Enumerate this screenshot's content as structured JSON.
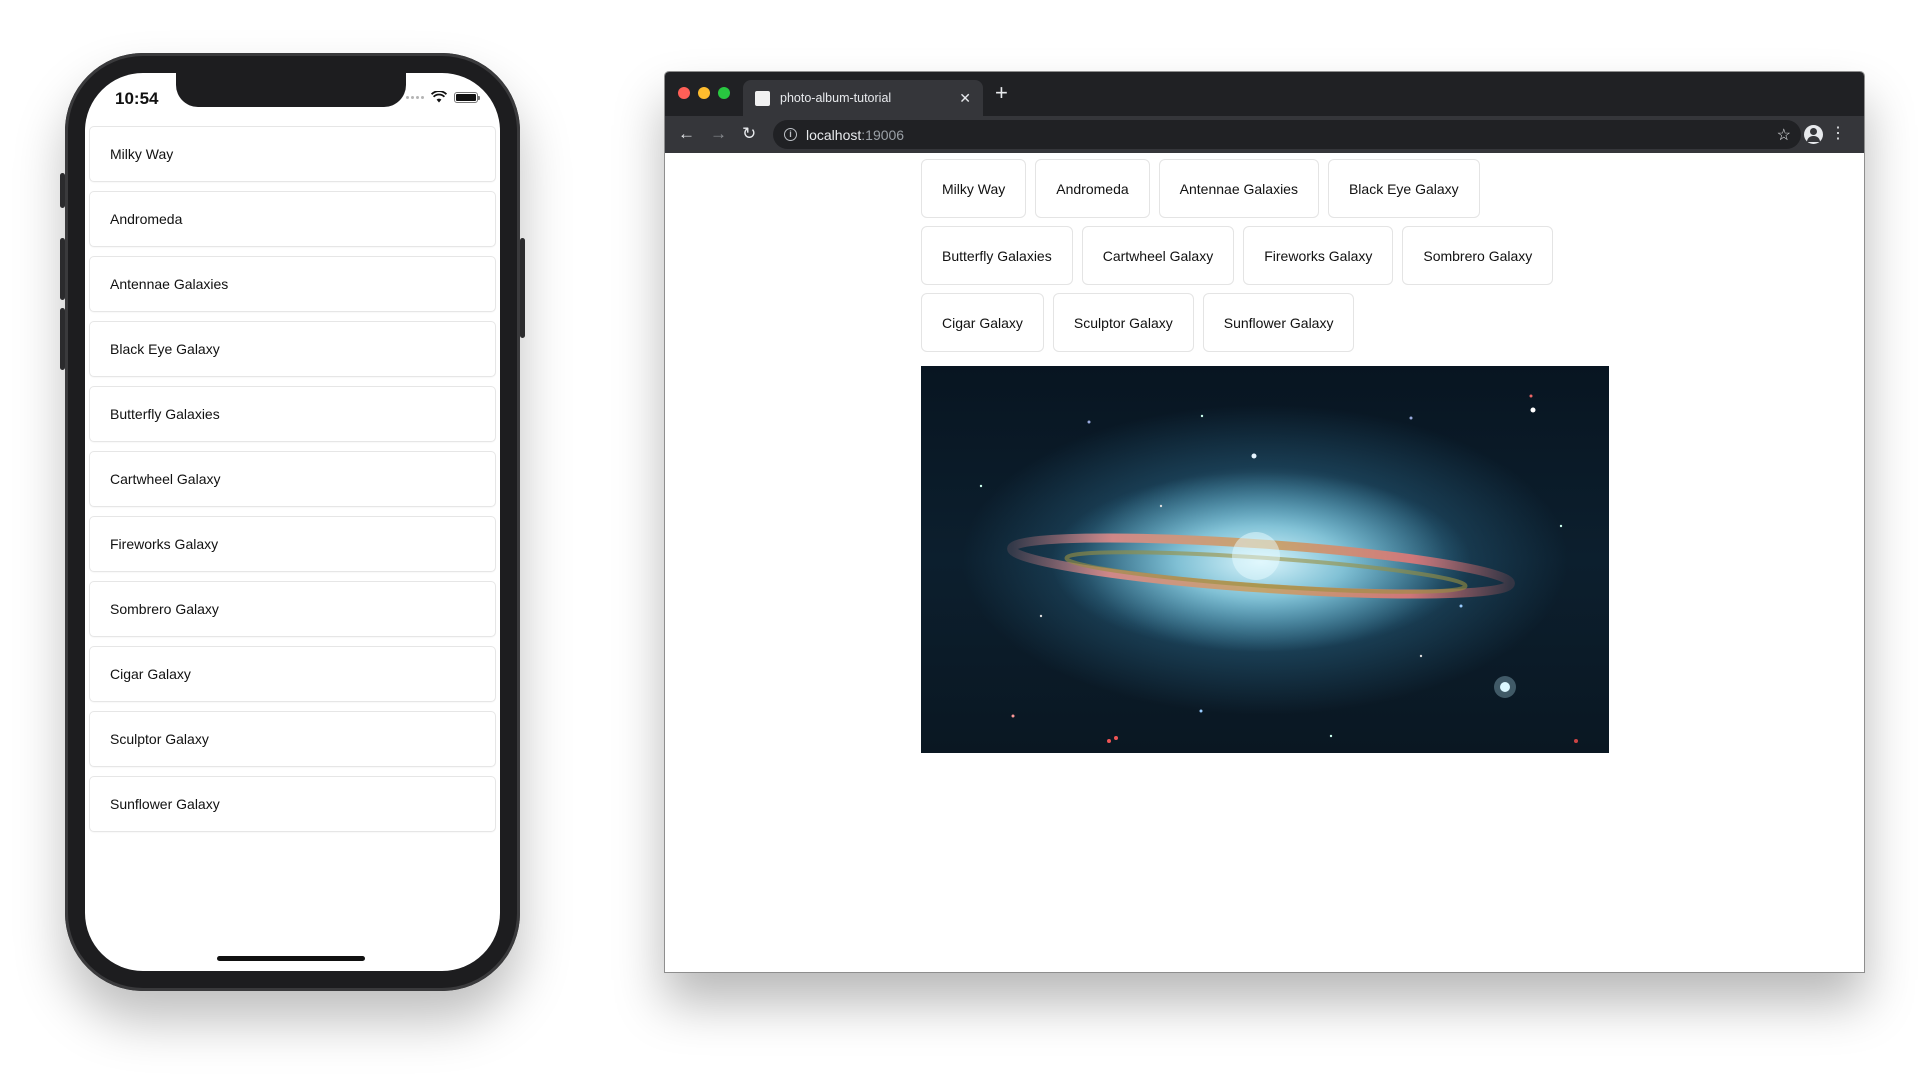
{
  "phone": {
    "status_time": "10:54",
    "items": [
      "Milky Way",
      "Andromeda",
      "Antennae Galaxies",
      "Black Eye Galaxy",
      "Butterfly Galaxies",
      "Cartwheel Galaxy",
      "Fireworks Galaxy",
      "Sombrero Galaxy",
      "Cigar Galaxy",
      "Sculptor Galaxy",
      "Sunflower Galaxy"
    ]
  },
  "browser": {
    "tab_title": "photo-album-tutorial",
    "url_host": "localhost",
    "url_port": ":19006",
    "buttons_rows": [
      [
        "Milky Way",
        "Andromeda",
        "Antennae Galaxies",
        "Black Eye Galaxy"
      ],
      [
        "Butterfly Galaxies",
        "Cartwheel Galaxy",
        "Fireworks Galaxy",
        "Sombrero Galaxy"
      ],
      [
        "Cigar Galaxy",
        "Sculptor Galaxy",
        "Sunflower Galaxy"
      ]
    ]
  },
  "colors": {
    "traffic_red": "#ff5f57",
    "traffic_yellow": "#febc2e",
    "traffic_green": "#28c840",
    "chrome_dark": "#202124",
    "chrome_toolbar": "#35363a"
  },
  "icons": {
    "back": "arrow-left-icon",
    "forward": "arrow-right-icon",
    "reload": "reload-icon",
    "bookmark": "star-icon",
    "profile": "profile-icon",
    "menu": "kebab-menu-icon"
  }
}
